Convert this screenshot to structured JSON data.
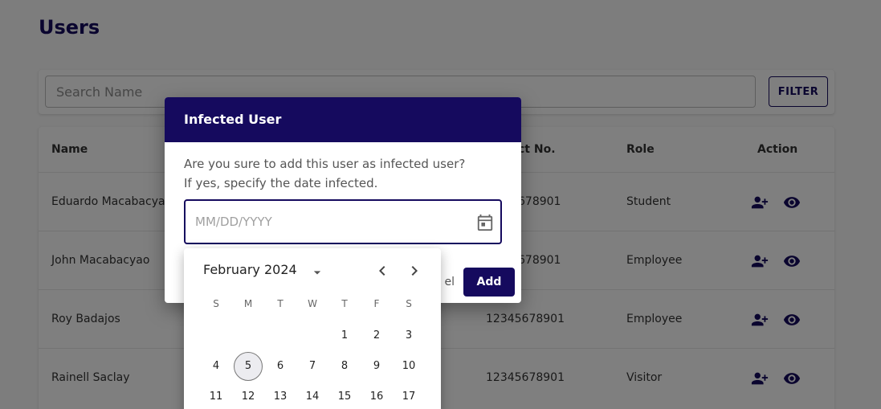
{
  "page": {
    "title": "Users"
  },
  "search": {
    "placeholder": "Search Name",
    "filter_label": "FILTER"
  },
  "table": {
    "headers": {
      "name": "Name",
      "contact": "ct No.",
      "role": "Role",
      "action": "Action"
    },
    "rows": [
      {
        "name": "Eduardo Macabacya",
        "contact": "678901",
        "role": "Student"
      },
      {
        "name": "John Macabacyao",
        "contact": "678901",
        "role": "Employee"
      },
      {
        "name": "Roy Badajos",
        "contact": "12345678901",
        "role": "Employee"
      },
      {
        "name": "Rainell Saclay",
        "contact": "12345678901",
        "role": "Visitor"
      }
    ],
    "action_icons": [
      "person-add-icon",
      "eye-icon"
    ]
  },
  "dialog": {
    "title": "Infected User",
    "message_line1": "Are you sure to add this user as infected user?",
    "message_line2": "If yes, specify the date infected.",
    "date_placeholder": "MM/DD/YYYY",
    "cancel_label": "el",
    "add_label": "Add"
  },
  "calendar": {
    "month_label": "February 2024",
    "weekdays": [
      "S",
      "M",
      "T",
      "W",
      "T",
      "F",
      "S"
    ],
    "week1": [
      "",
      "",
      "",
      "",
      "1",
      "2",
      "3"
    ],
    "week2": [
      "4",
      "5",
      "6",
      "7",
      "8",
      "9",
      "10"
    ],
    "week3": [
      "11",
      "12",
      "13",
      "14",
      "15",
      "16",
      "17"
    ],
    "today": "5"
  },
  "colors": {
    "primary": "#150a5e",
    "backdrop": "rgba(0,0,0,0.5)"
  }
}
